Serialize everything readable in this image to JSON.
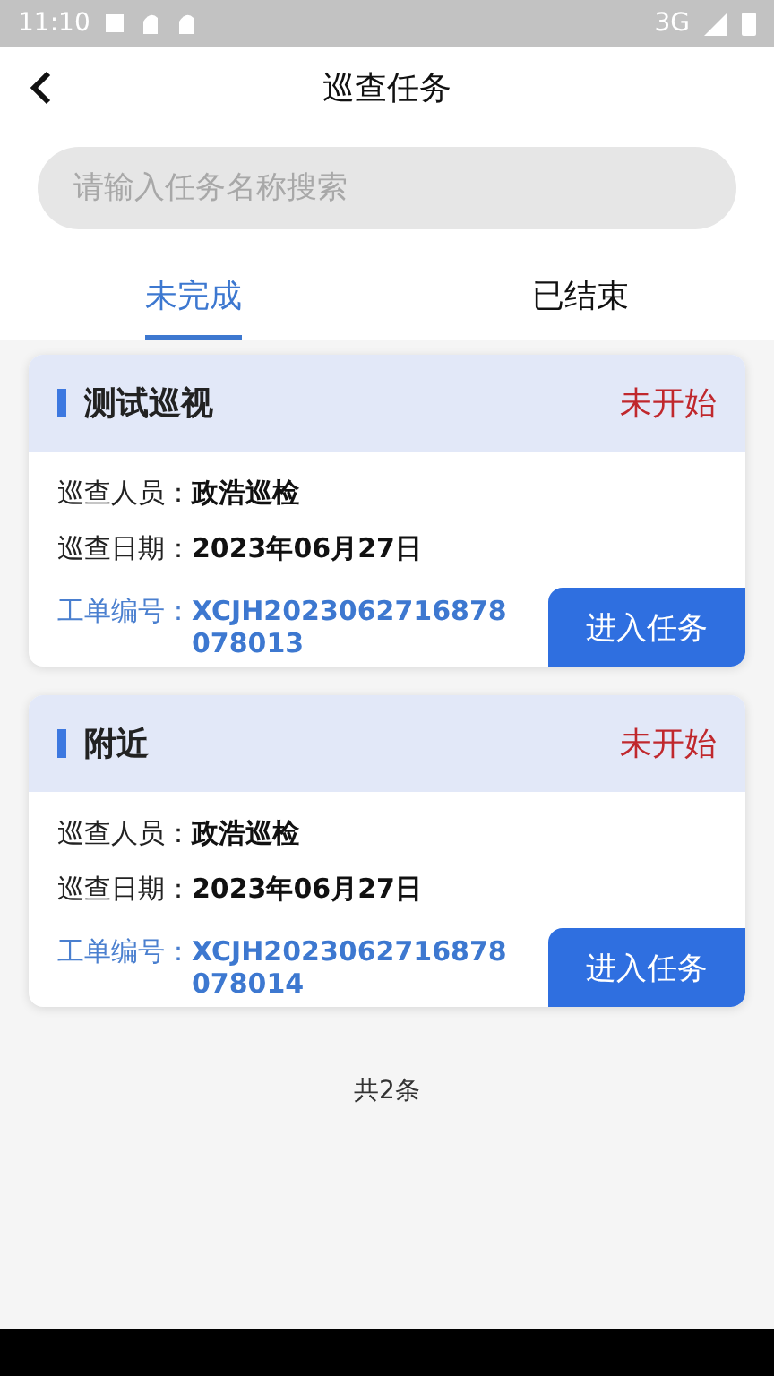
{
  "status_bar": {
    "time": "11:10",
    "network": "3G"
  },
  "header": {
    "title": "巡查任务"
  },
  "search": {
    "placeholder": "请输入任务名称搜索"
  },
  "tabs": [
    {
      "label": "未完成",
      "selected": true
    },
    {
      "label": "已结束",
      "selected": false
    }
  ],
  "tasks": [
    {
      "name": "测试巡视",
      "status": "未开始",
      "inspector_label": "巡查人员：",
      "inspector": "政浩巡检",
      "date_label": "巡查日期：",
      "date": "2023年06月27日",
      "order_label": "工单编号：",
      "order_no": "XCJH2023062716878078013",
      "action": "进入任务"
    },
    {
      "name": "附近",
      "status": "未开始",
      "inspector_label": "巡查人员：",
      "inspector": "政浩巡检",
      "date_label": "巡查日期：",
      "date": "2023年06月27日",
      "order_label": "工单编号：",
      "order_no": "XCJH2023062716878078014",
      "action": "进入任务"
    }
  ],
  "footer": {
    "count": "共2条"
  }
}
